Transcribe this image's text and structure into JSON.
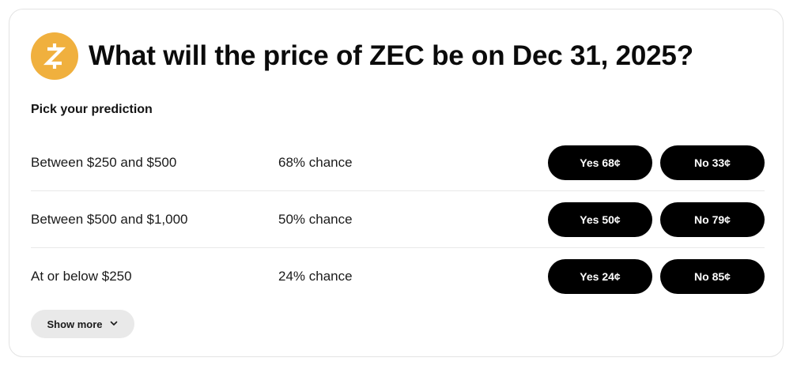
{
  "header": {
    "icon": "zcash-coin-icon",
    "icon_color": "#f0b03e",
    "title": "What will the price of ZEC be on Dec 31, 2025?"
  },
  "subtitle": "Pick your prediction",
  "rows": [
    {
      "range": "Between $250 and $500",
      "chance": "68% chance",
      "yes": "Yes 68¢",
      "no": "No 33¢"
    },
    {
      "range": "Between $500 and $1,000",
      "chance": "50% chance",
      "yes": "Yes 50¢",
      "no": "No 79¢"
    },
    {
      "range": "At or below $250",
      "chance": "24% chance",
      "yes": "Yes 24¢",
      "no": "No 85¢"
    }
  ],
  "show_more": {
    "label": "Show more",
    "icon": "chevron-down-icon"
  }
}
